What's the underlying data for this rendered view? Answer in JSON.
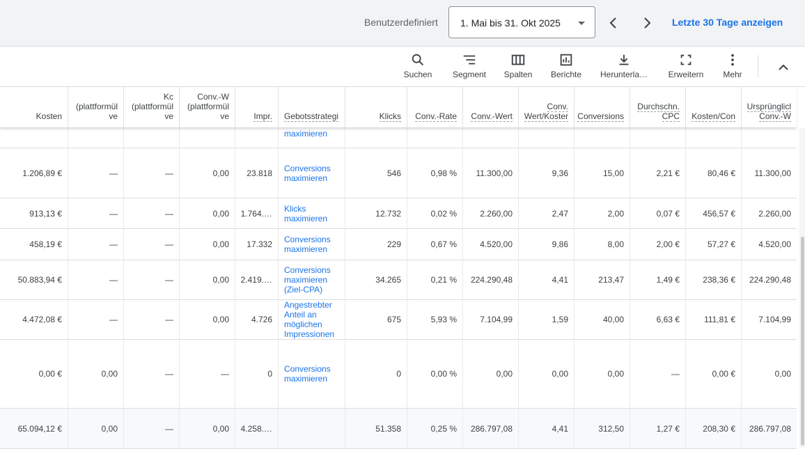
{
  "header": {
    "period_label": "Benutzerdefiniert",
    "date_range": "1. Mai bis 31. Okt 2025",
    "last_days": "Letzte 30 Tage anzeigen"
  },
  "toolbar": {
    "search": "Suchen",
    "segment": "Segment",
    "columns": "Spalten",
    "reports": "Berichte",
    "download": "Herunterla…",
    "expand": "Erweitern",
    "more": "Mehr"
  },
  "columns": [
    "Kosten",
    "(plattformül ve",
    "Kc (plattformül ve",
    "Conv.-W (plattformül ve",
    "Impr.",
    "Gebotsstrategi",
    "Klicks",
    "Conv.-Rate",
    "Conv.-Wert",
    "Conv. Wert/Koster",
    "Conversions",
    "Durchschn. CPC",
    "Kosten/Con",
    "Ursprünglicl Conv.-W"
  ],
  "header_lines": {
    "c1": [
      "(plattformül",
      "ve"
    ],
    "c2": [
      "Kc",
      "(plattformül",
      "ve"
    ],
    "c3": [
      "Conv.-W",
      "(plattformül",
      "ve"
    ],
    "c9": [
      "Conv.",
      "Wert/Koster"
    ],
    "c11": [
      "Durchschn.",
      "CPC"
    ],
    "c13": [
      "Ursprünglicl",
      "Conv.-W"
    ]
  },
  "partial_row_strategy": "maximieren",
  "rows": [
    {
      "kosten": "1.206,89 €",
      "c1": "—",
      "c2": "—",
      "c3": "0,00",
      "impr": "23.818",
      "strategy": "Conversions maximieren",
      "klicks": "546",
      "rate": "0,98 %",
      "wert": "11.300,00",
      "wk": "9,36",
      "conv": "15,00",
      "cpc": "2,21 €",
      "kc": "80,46 €",
      "orig": "11.300,00"
    },
    {
      "kosten": "913,13 €",
      "c1": "—",
      "c2": "—",
      "c3": "0,00",
      "impr": "1.764.…",
      "strategy": "Klicks maximieren",
      "klicks": "12.732",
      "rate": "0,02 %",
      "wert": "2.260,00",
      "wk": "2,47",
      "conv": "2,00",
      "cpc": "0,07 €",
      "kc": "456,57 €",
      "orig": "2.260,00"
    },
    {
      "kosten": "458,19 €",
      "c1": "—",
      "c2": "—",
      "c3": "0,00",
      "impr": "17.332",
      "strategy": "Conversions maximieren",
      "klicks": "229",
      "rate": "0,67 %",
      "wert": "4.520,00",
      "wk": "9,86",
      "conv": "8,00",
      "cpc": "2,00 €",
      "kc": "57,27 €",
      "orig": "4.520,00"
    },
    {
      "kosten": "50.883,94 €",
      "c1": "—",
      "c2": "—",
      "c3": "0,00",
      "impr": "2.419.…",
      "strategy": "Conversions maximieren (Ziel-CPA)",
      "klicks": "34.265",
      "rate": "0,21 %",
      "wert": "224.290,48",
      "wk": "4,41",
      "conv": "213,47",
      "cpc": "1,49 €",
      "kc": "238,36 €",
      "orig": "224.290,48"
    },
    {
      "kosten": "4.472,08 €",
      "c1": "—",
      "c2": "—",
      "c3": "0,00",
      "impr": "4.726",
      "strategy": "Angestrebter Anteil an möglichen Impressionen",
      "klicks": "675",
      "rate": "5,93 %",
      "wert": "7.104,99",
      "wk": "1,59",
      "conv": "40,00",
      "cpc": "6,63 €",
      "kc": "111,81 €",
      "orig": "7.104,99"
    },
    {
      "kosten": "0,00 €",
      "c1": "0,00",
      "c2": "—",
      "c3": "—",
      "impr": "0",
      "strategy": "Conversions maximieren",
      "klicks": "0",
      "rate": "0,00 %",
      "wert": "0,00",
      "wk": "0,00",
      "conv": "0,00",
      "cpc": "—",
      "kc": "0,00 €",
      "orig": "0,00"
    }
  ],
  "total": {
    "kosten": "65.094,12 €",
    "c1": "0,00",
    "c2": "—",
    "c3": "0,00",
    "impr": "4.258.…",
    "strategy": "",
    "klicks": "51.358",
    "rate": "0,25 %",
    "wert": "286.797,08",
    "wk": "4,41",
    "conv": "312,50",
    "cpc": "1,27 €",
    "kc": "208,30 €",
    "orig": "286.797,08"
  }
}
